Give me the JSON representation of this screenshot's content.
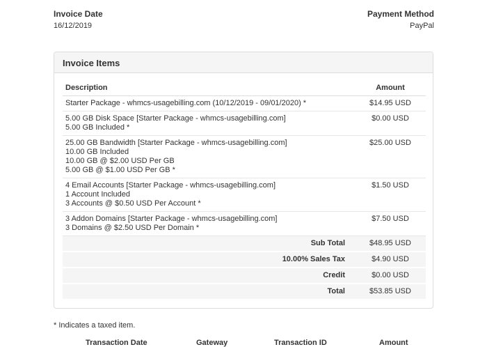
{
  "invoice_date": {
    "label": "Invoice Date",
    "value": "16/12/2019"
  },
  "payment_method": {
    "label": "Payment Method",
    "value": "PayPal"
  },
  "invoice_items": {
    "title": "Invoice Items",
    "headers": {
      "description": "Description",
      "amount": "Amount"
    },
    "rows": [
      {
        "lines": [
          "Starter Package - whmcs-usagebilling.com (10/12/2019 - 09/01/2020) *"
        ],
        "amount": "$14.95 USD"
      },
      {
        "lines": [
          "5.00 GB Disk Space [Starter Package - whmcs-usagebilling.com]",
          "5.00 GB Included *"
        ],
        "amount": "$0.00 USD"
      },
      {
        "lines": [
          "25.00 GB Bandwidth [Starter Package - whmcs-usagebilling.com]",
          "10.00 GB Included",
          "10.00 GB @ $2.00 USD Per GB",
          "5.00 GB @ $1.00 USD Per GB *"
        ],
        "amount": "$25.00 USD"
      },
      {
        "lines": [
          "4 Email Accounts [Starter Package - whmcs-usagebilling.com]",
          "1 Account Included",
          "3 Accounts @ $0.50 USD Per Account *"
        ],
        "amount": "$1.50 USD"
      },
      {
        "lines": [
          "3 Addon Domains [Starter Package - whmcs-usagebilling.com]",
          "3 Domains @ $2.50 USD Per Domain *"
        ],
        "amount": "$7.50 USD"
      }
    ],
    "summary": [
      {
        "label": "Sub Total",
        "value": "$48.95 USD"
      },
      {
        "label": "10.00% Sales Tax",
        "value": "$4.90 USD"
      },
      {
        "label": "Credit",
        "value": "$0.00 USD"
      },
      {
        "label": "Total",
        "value": "$53.85 USD"
      }
    ]
  },
  "taxed_note": "* Indicates a taxed item.",
  "transactions": {
    "headers": [
      "Transaction Date",
      "Gateway",
      "Transaction ID",
      "Amount"
    ]
  }
}
